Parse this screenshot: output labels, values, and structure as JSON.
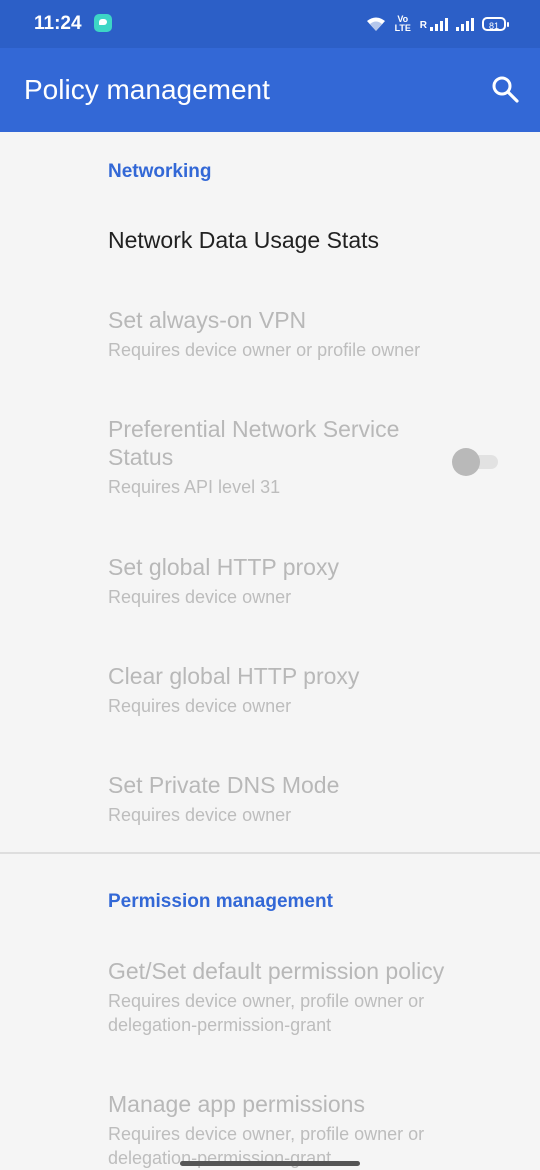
{
  "status_bar": {
    "time": "11:24",
    "app_icon": "chat-bubble-icon",
    "volte_top": "Vo",
    "volte_bottom": "LTE",
    "roaming_label": "R",
    "battery_level": "81"
  },
  "app_bar": {
    "title": "Policy management",
    "search_icon": "search-icon",
    "background": "#3368d6"
  },
  "sections": [
    {
      "header": "Networking",
      "items": [
        {
          "title": "Network Data Usage Stats",
          "summary": "",
          "enabled": true
        },
        {
          "title": "Set always-on VPN",
          "summary": "Requires device owner or profile owner",
          "enabled": false
        },
        {
          "title": "Preferential Network Service Status",
          "summary": "Requires API level 31",
          "enabled": false,
          "toggle": "off"
        },
        {
          "title": "Set global HTTP proxy",
          "summary": "Requires device owner",
          "enabled": false
        },
        {
          "title": "Clear global HTTP proxy",
          "summary": "Requires device owner",
          "enabled": false
        },
        {
          "title": "Set Private DNS Mode",
          "summary": "Requires device owner",
          "enabled": false
        }
      ]
    },
    {
      "header": "Permission management",
      "items": [
        {
          "title": "Get/Set default permission policy",
          "summary": "Requires device owner, profile owner or delegation-permission-grant",
          "enabled": false
        },
        {
          "title": "Manage app permissions",
          "summary": "Requires device owner, profile owner or delegation-permission-grant",
          "enabled": false
        }
      ]
    }
  ],
  "colors": {
    "accent": "#3368d6",
    "status_bar": "#2c5fc7",
    "disabled_text": "#b8b8b8"
  }
}
